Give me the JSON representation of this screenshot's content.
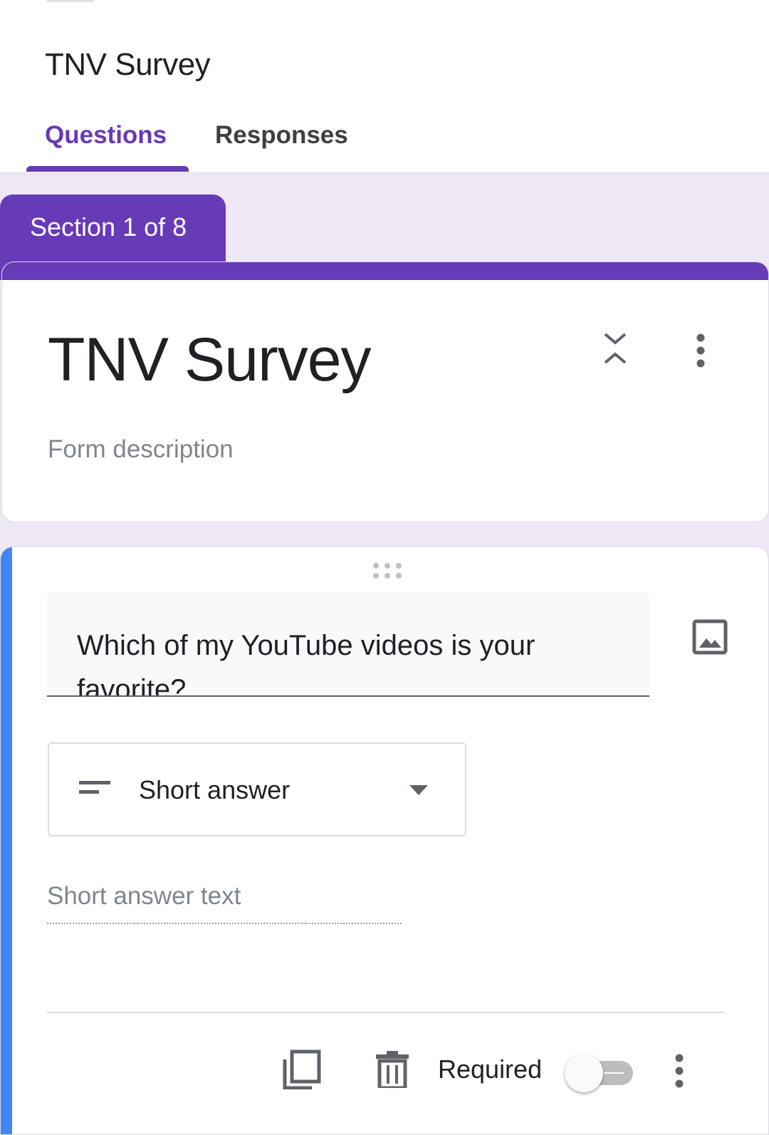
{
  "header": {
    "title": "TNV Survey",
    "tabs": [
      {
        "label": "Questions",
        "active": true
      },
      {
        "label": "Responses",
        "active": false
      }
    ]
  },
  "section": {
    "label": "Section 1 of 8"
  },
  "form": {
    "title": "TNV Survey",
    "description_placeholder": "Form description"
  },
  "question": {
    "text": "Which of my YouTube videos is your favorite?",
    "type_label": "Short answer",
    "answer_placeholder": "Short answer text",
    "required_label": "Required",
    "required": false
  },
  "colors": {
    "accent": "#673ab7",
    "background": "#ede7f6",
    "focus_bar": "#4285f4"
  },
  "icons": {
    "collapse": "unfold-less-icon",
    "more": "more-vert-icon",
    "image": "image-icon",
    "drag": "drag-handle-icon",
    "type": "short-text-icon",
    "caret": "dropdown-caret-icon",
    "copy": "content-copy-icon",
    "delete": "delete-icon"
  }
}
